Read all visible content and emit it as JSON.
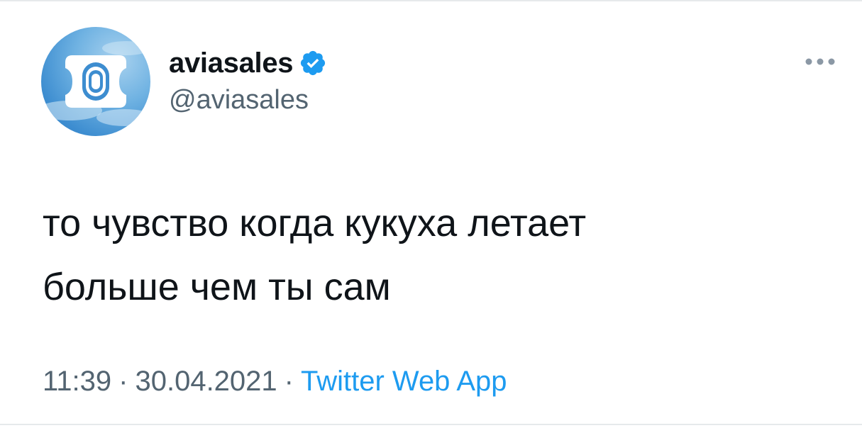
{
  "tweet": {
    "author": {
      "display_name": "aviasales",
      "handle": "@aviasales",
      "verified": true
    },
    "text": "то чувство когда кукуха летает\nбольше чем ты сам",
    "time": "11:39",
    "date": "30.04.2021",
    "separator": "·",
    "source": "Twitter Web App"
  },
  "icons": {
    "verified": "verified-badge-icon",
    "more": "more-options-icon",
    "avatar_logo": "porthole-window-icon"
  },
  "colors": {
    "text": "#0f1419",
    "secondary": "#536471",
    "link": "#1d9bf0",
    "verified": "#1d9bf0",
    "avatar_sky": "#4a97d6"
  }
}
